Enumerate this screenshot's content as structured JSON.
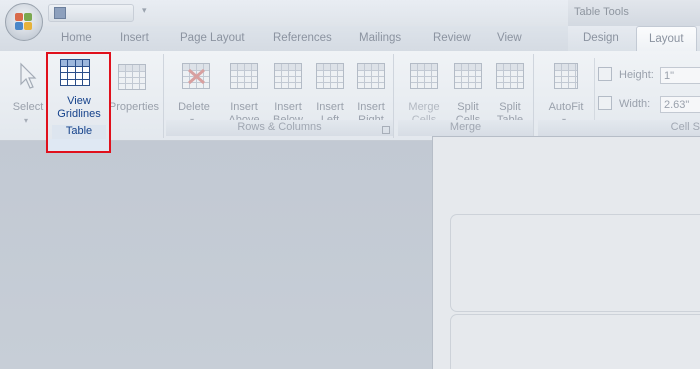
{
  "window": {
    "context_tools_title": "Table Tools"
  },
  "tabs": [
    {
      "label": "Home"
    },
    {
      "label": "Insert"
    },
    {
      "label": "Page Layout"
    },
    {
      "label": "References"
    },
    {
      "label": "Mailings"
    },
    {
      "label": "Review"
    },
    {
      "label": "View"
    },
    {
      "label": "Design"
    },
    {
      "label": "Layout"
    }
  ],
  "ribbon": {
    "table_group": {
      "label": "Table",
      "select": "Select",
      "view_gridlines_line1": "View",
      "view_gridlines_line2": "Gridlines",
      "properties": "Properties"
    },
    "rows_columns_group": {
      "label": "Rows & Columns",
      "delete": "Delete",
      "insert_above_1": "Insert",
      "insert_above_2": "Above",
      "insert_below_1": "Insert",
      "insert_below_2": "Below",
      "insert_left_1": "Insert",
      "insert_left_2": "Left",
      "insert_right_1": "Insert",
      "insert_right_2": "Right"
    },
    "merge_group": {
      "label": "Merge",
      "merge_cells_1": "Merge",
      "merge_cells_2": "Cells",
      "split_cells_1": "Split",
      "split_cells_2": "Cells",
      "split_table_1": "Split",
      "split_table_2": "Table"
    },
    "cell_size_group": {
      "label": "Cell S",
      "autofit": "AutoFit",
      "height_label": "Height:",
      "height_value": "1\"",
      "width_label": "Width:",
      "width_value": "2.63\""
    }
  },
  "colors": {
    "highlight_border": "#e0101c",
    "active_text": "#15428b",
    "disabled_text": "#9aa1ac"
  }
}
